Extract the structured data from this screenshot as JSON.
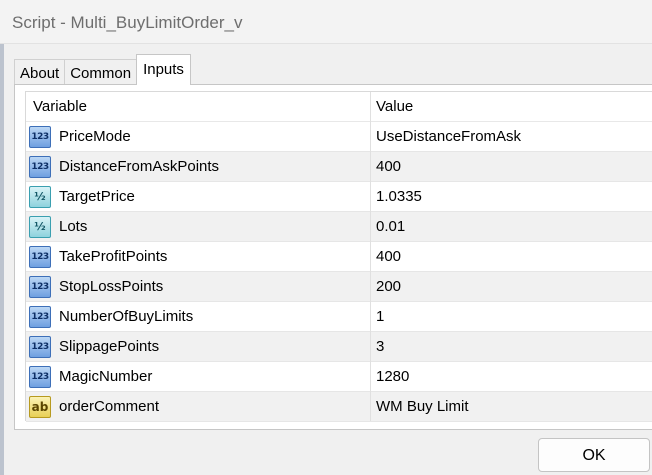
{
  "window": {
    "title": "Script - Multi_BuyLimitOrder_v"
  },
  "tabs": [
    {
      "label": "About"
    },
    {
      "label": "Common"
    },
    {
      "label": "Inputs",
      "active": true
    }
  ],
  "grid": {
    "columns": {
      "variable": "Variable",
      "value": "Value"
    },
    "rows": [
      {
        "type": "int",
        "icon": "integer-type-icon",
        "badge": "123",
        "variable": "PriceMode",
        "value": "UseDistanceFromAsk"
      },
      {
        "type": "int",
        "icon": "integer-type-icon",
        "badge": "123",
        "variable": "DistanceFromAskPoints",
        "value": "400"
      },
      {
        "type": "dbl",
        "icon": "double-type-icon",
        "badge": "½",
        "variable": "TargetPrice",
        "value": "1.0335"
      },
      {
        "type": "dbl",
        "icon": "double-type-icon",
        "badge": "½",
        "variable": "Lots",
        "value": "0.01"
      },
      {
        "type": "int",
        "icon": "integer-type-icon",
        "badge": "123",
        "variable": "TakeProfitPoints",
        "value": "400"
      },
      {
        "type": "int",
        "icon": "integer-type-icon",
        "badge": "123",
        "variable": "StopLossPoints",
        "value": "200"
      },
      {
        "type": "int",
        "icon": "integer-type-icon",
        "badge": "123",
        "variable": "NumberOfBuyLimits",
        "value": "1"
      },
      {
        "type": "int",
        "icon": "integer-type-icon",
        "badge": "123",
        "variable": "SlippagePoints",
        "value": "3"
      },
      {
        "type": "int",
        "icon": "integer-type-icon",
        "badge": "123",
        "variable": "MagicNumber",
        "value": "1280"
      },
      {
        "type": "str",
        "icon": "string-type-icon",
        "badge": "ab",
        "variable": "orderComment",
        "value": "WM Buy Limit"
      }
    ]
  },
  "buttons": {
    "ok_label": "OK"
  }
}
